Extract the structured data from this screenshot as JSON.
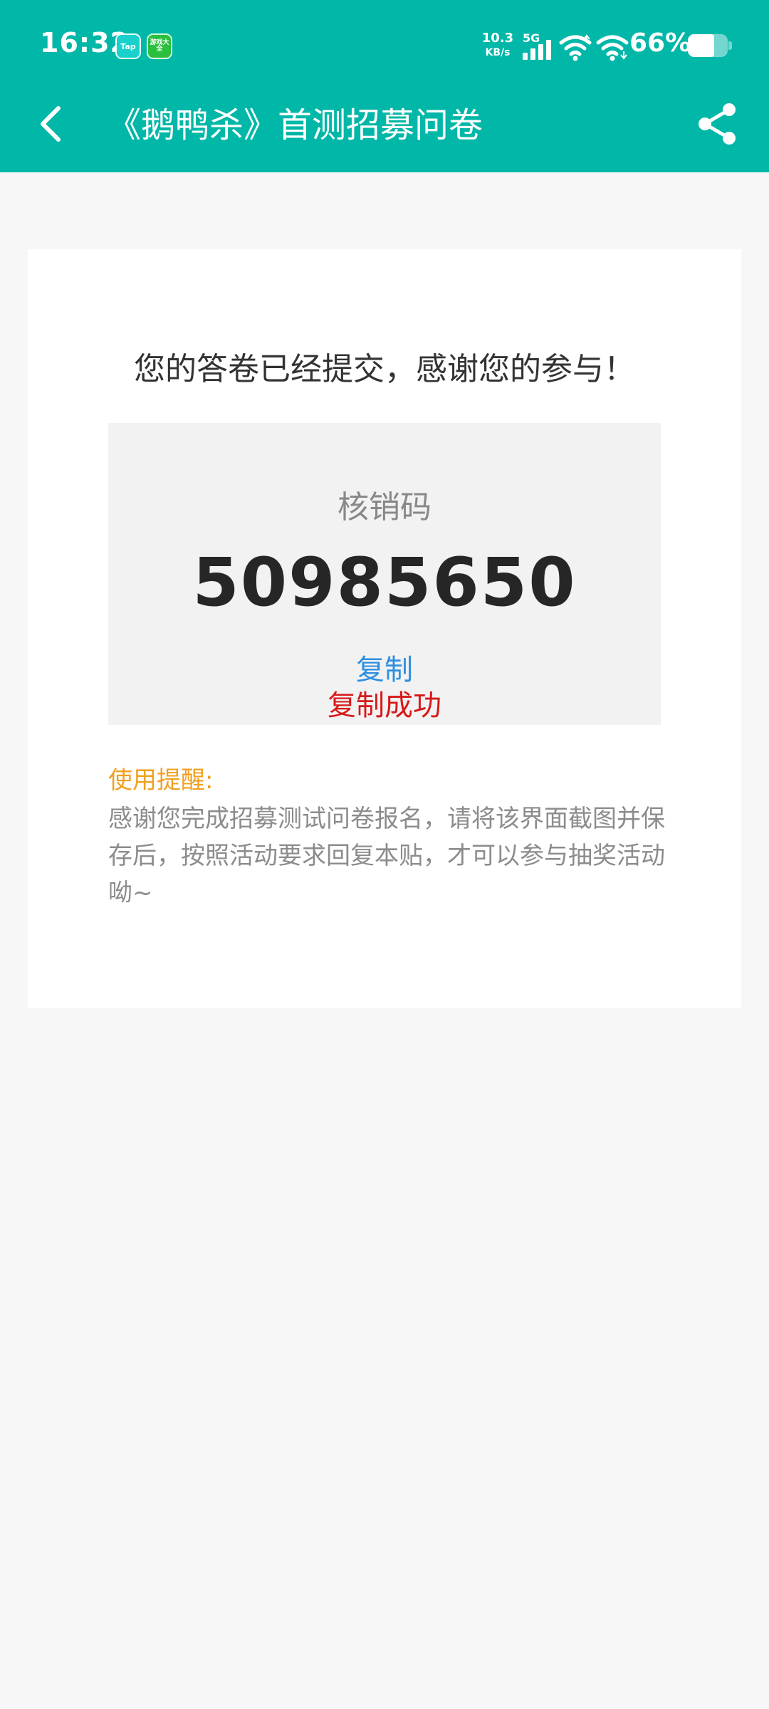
{
  "status_bar": {
    "time": "16:32",
    "app_badge_1": "Tap",
    "app_badge_2": "游戏大全",
    "net_speed_value": "10.3",
    "net_speed_unit": "KB/s",
    "network_type": "5G",
    "battery_pct": "66%",
    "battery_level": 0.66
  },
  "nav": {
    "title": "《鹅鸭杀》首测招募问卷",
    "back_icon": "chevron-left-icon",
    "share_icon": "share-icon"
  },
  "content": {
    "headline": "您的答卷已经提交，感谢您的参与！",
    "code_label": "核销码",
    "code_value": "50985650",
    "copy_label": "复制",
    "copy_status": "复制成功",
    "tip_title": "使用提醒:",
    "tip_body": "感谢您完成招募测试问卷报名，请将该界面截图并保存后，按照活动要求回复本贴，才可以参与抽奖活动呦~"
  },
  "colors": {
    "brand": "#00b7a8",
    "copy_link": "#2d8fe0",
    "success": "#d71a1a",
    "tip_title": "#f0a020"
  }
}
